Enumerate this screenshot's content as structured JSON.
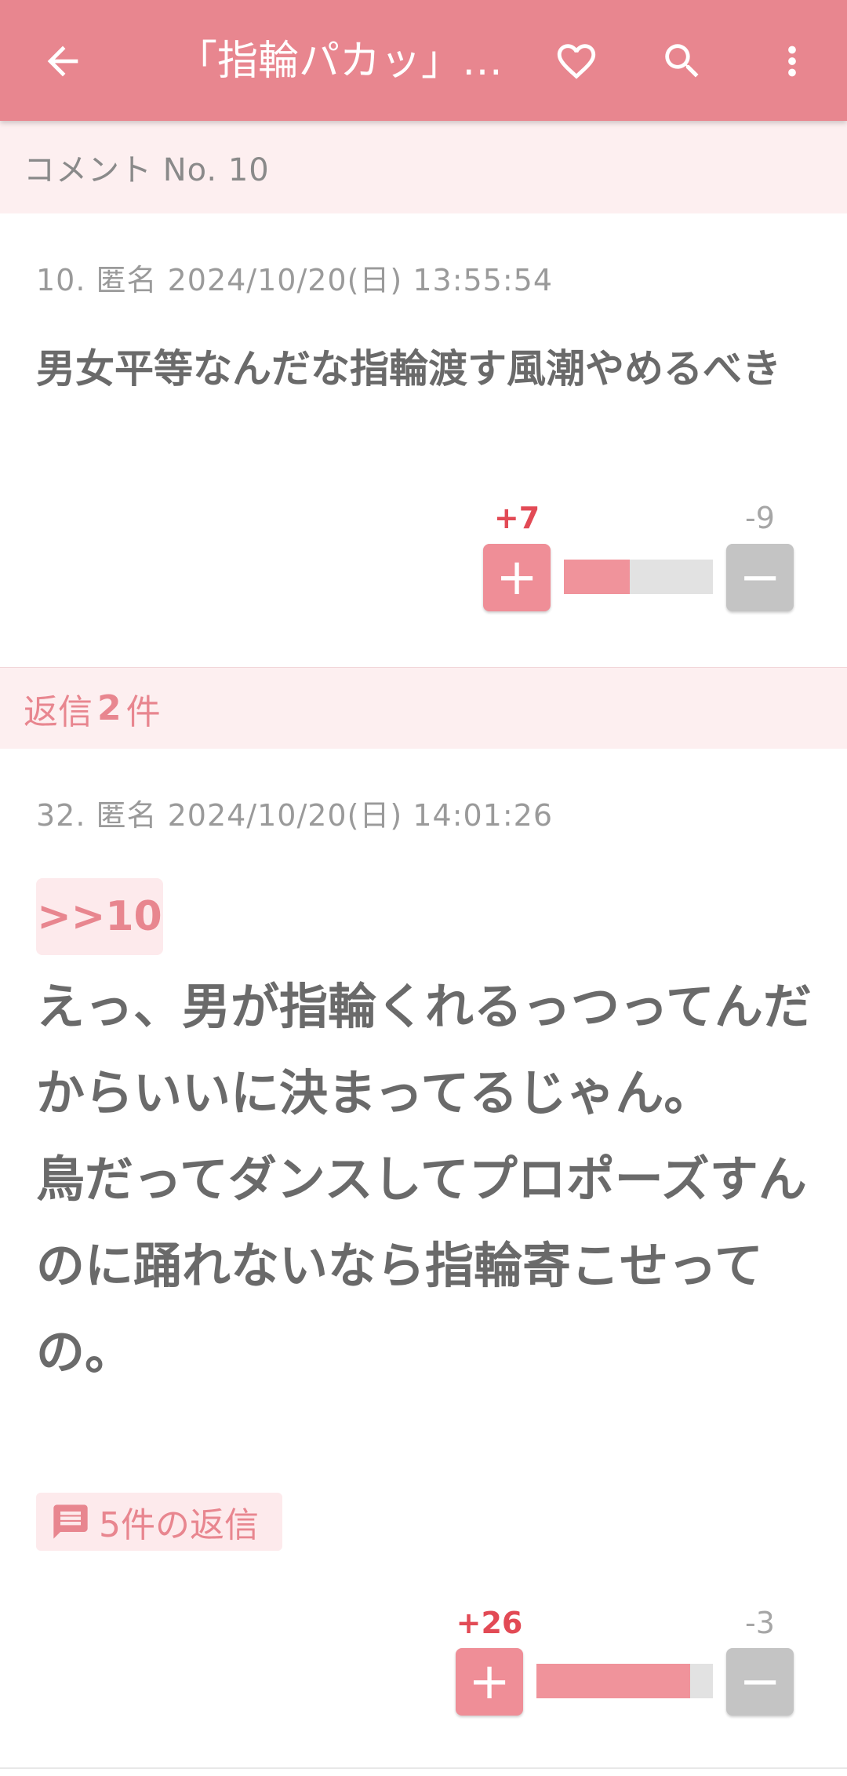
{
  "appbar": {
    "title": "「指輪パカッ」…",
    "background": "#e8868f"
  },
  "comment_header": "コメント No. 10",
  "comment": {
    "meta": "10.  匿名  2024/10/20(日) 13:55:54",
    "body": "男女平等なんだな指輪渡す風潮やめるべき",
    "plus": "+7",
    "minus": "-9",
    "plus_fraction": 0.44
  },
  "replies_header": {
    "prefix": "返信",
    "count": "2",
    "suffix": "件"
  },
  "reply": {
    "meta": "32.  匿名  2024/10/20(日) 14:01:26",
    "anchor": ">>10",
    "body": "えっ、男が指輪くれるっつってんだからいいに決まってるじゃん。\n鳥だってダンスしてプロポーズすんのに踊れないなら指輪寄こせっての。",
    "reply_link": "5件の返信",
    "plus": "+26",
    "minus": "-3",
    "plus_fraction": 0.87
  }
}
